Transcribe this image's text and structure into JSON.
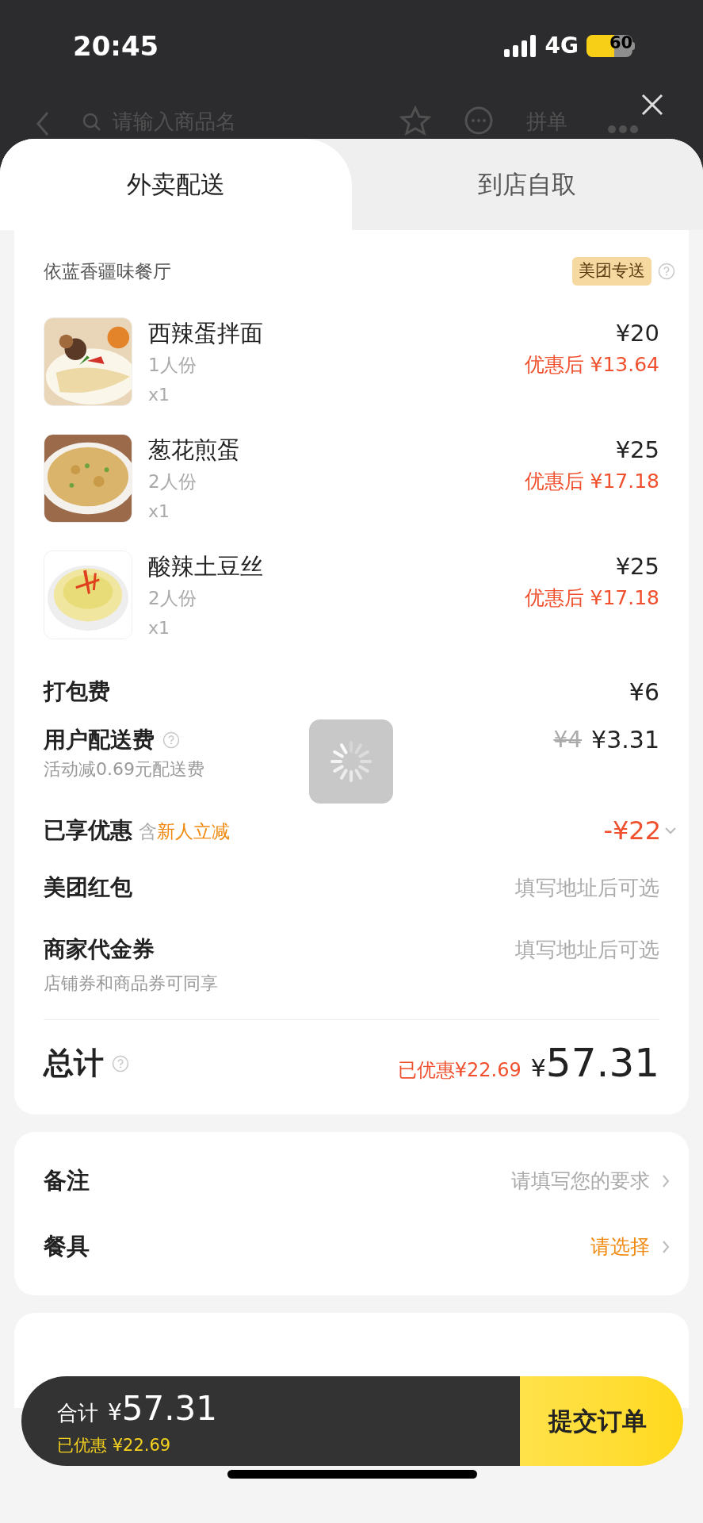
{
  "status_bar": {
    "time": "20:45",
    "network": "4G",
    "battery": "60"
  },
  "background_nav": {
    "search_placeholder": "请输入商品名",
    "group_order": "拼单"
  },
  "tabs": [
    {
      "label": "外卖配送",
      "selected": true
    },
    {
      "label": "到店自取",
      "selected": false
    }
  ],
  "store": {
    "name": "依蓝香疆味餐厅",
    "badge": "美团专送"
  },
  "items": [
    {
      "name": "西辣蛋拌面",
      "portion": "1人份",
      "qty": "x1",
      "price": "¥20",
      "discounted": "优惠后 ¥13.64"
    },
    {
      "name": "葱花煎蛋",
      "portion": "2人份",
      "qty": "x1",
      "price": "¥25",
      "discounted": "优惠后 ¥17.18"
    },
    {
      "name": "酸辣土豆丝",
      "portion": "2人份",
      "qty": "x1",
      "price": "¥25",
      "discounted": "优惠后 ¥17.18"
    }
  ],
  "packing_fee": {
    "label": "打包费",
    "value": "¥6"
  },
  "delivery_fee": {
    "label": "用户配送费",
    "note": "活动减0.69元配送费",
    "original": "¥4",
    "value": "¥3.31"
  },
  "discount": {
    "label": "已享优惠",
    "prefix": "含",
    "highlight": "新人立减",
    "value": "-¥22"
  },
  "coupons": [
    {
      "label": "美团红包",
      "value": "填写地址后可选"
    },
    {
      "label": "商家代金券",
      "value": "填写地址后可选",
      "note": "店铺券和商品券可同享"
    }
  ],
  "total": {
    "label": "总计",
    "saved": "已优惠¥22.69",
    "currency": "¥",
    "amount": "57.31"
  },
  "options": [
    {
      "label": "备注",
      "value": "请填写您的要求",
      "kind": "placeholder"
    },
    {
      "label": "餐具",
      "value": "请选择",
      "kind": "prompt"
    }
  ],
  "checkout": {
    "label": "合计",
    "currency": "¥",
    "amount": "57.31",
    "saved": "已优惠 ¥22.69",
    "submit": "提交订单"
  },
  "loading": true
}
